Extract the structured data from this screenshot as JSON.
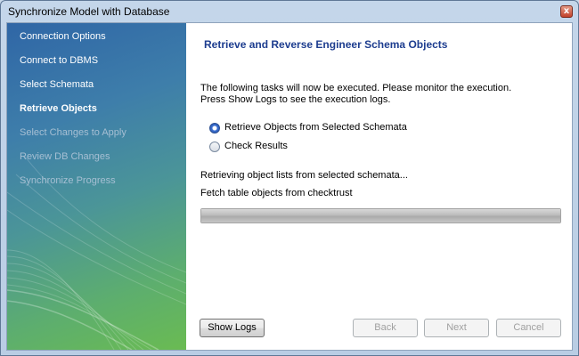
{
  "window": {
    "title": "Synchronize Model with Database",
    "close_label": "x"
  },
  "steps": [
    {
      "label": "Connection Options",
      "state": "done"
    },
    {
      "label": "Connect to DBMS",
      "state": "done"
    },
    {
      "label": "Select Schemata",
      "state": "done"
    },
    {
      "label": "Retrieve Objects",
      "state": "current"
    },
    {
      "label": "Select Changes to Apply",
      "state": "pending"
    },
    {
      "label": "Review DB Changes",
      "state": "pending"
    },
    {
      "label": "Synchronize Progress",
      "state": "pending"
    }
  ],
  "page": {
    "heading": "Retrieve and Reverse Engineer Schema Objects",
    "description_line1": "The following tasks will now be executed. Please monitor the execution.",
    "description_line2": "Press Show Logs to see the execution logs.",
    "tasks": [
      {
        "label": "Retrieve Objects from Selected Schemata",
        "active": true
      },
      {
        "label": "Check Results",
        "active": false
      }
    ],
    "status_line1": "Retrieving object lists from selected schemata...",
    "status_line2": "Fetch table objects from checktrust",
    "progress_percent": 100
  },
  "buttons": {
    "show_logs": "Show Logs",
    "back": "Back",
    "next": "Next",
    "cancel": "Cancel"
  },
  "colors": {
    "heading": "#1d3d8f",
    "sidebar_top": "#2f66a6",
    "sidebar_bottom": "#6abb52"
  }
}
